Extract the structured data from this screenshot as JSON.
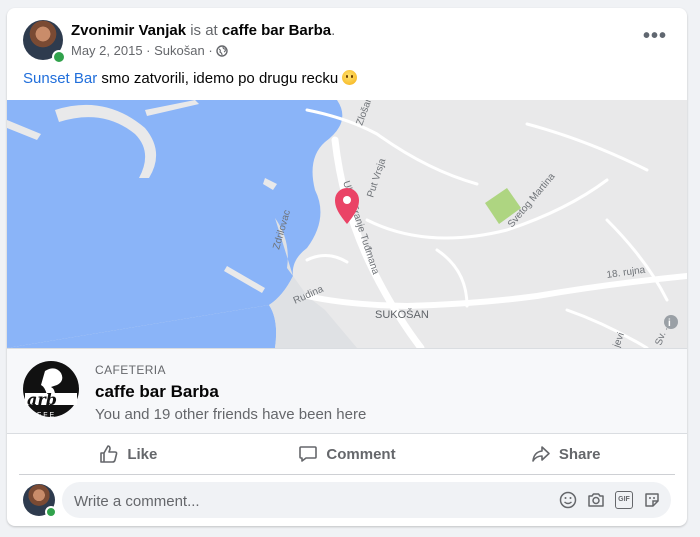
{
  "post": {
    "author": "Zvonimir Vanjak",
    "checkin_prefix": " is at ",
    "place_link": "caffe bar Barba",
    "period": ".",
    "date": "May 2, 2015",
    "separator": " · ",
    "location": "Sukošan",
    "separator2": " · ",
    "mention": "Sunset Bar",
    "text": " smo zatvorili, idemo po drugu recku "
  },
  "map": {
    "labels": {
      "zlosani": "Zlošani",
      "put_vrsja": "Put Vrsja",
      "ulica": "Ulica Franje Tuđmana",
      "svetog": "Svetog Martina",
      "rujna": "18. rujna",
      "zdrilovac": "Zdrilovac",
      "rudina": "Rudina",
      "sukosan": "SUKOŠAN",
      "jevi": "jevi",
      "sv": "Sv. ..."
    }
  },
  "place": {
    "category": "CAFETERIA",
    "name": "caffe bar Barba",
    "visited": "You and 19 other friends have been here",
    "logo_text": "arb",
    "logo_sub": "F F E"
  },
  "actions": {
    "like": "Like",
    "comment": "Comment",
    "share": "Share"
  },
  "composer": {
    "placeholder": "Write a comment..."
  },
  "colors": {
    "water": "#8ab4f8",
    "pin": "#ea4366",
    "park": "#aed581",
    "link": "#216fdb"
  }
}
